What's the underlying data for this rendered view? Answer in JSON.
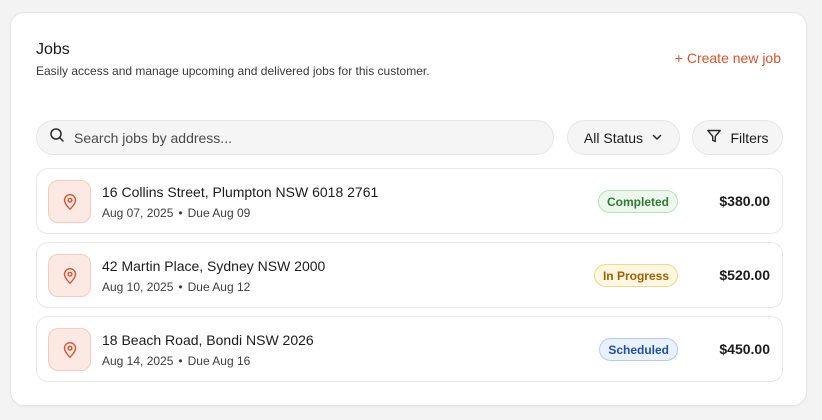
{
  "header": {
    "title": "Jobs",
    "subtitle": "Easily access and manage upcoming and delivered jobs for this customer.",
    "create_label": "+ Create new job"
  },
  "toolbar": {
    "search_placeholder": "Search jobs by address...",
    "search_value": "",
    "status_label": "All Status",
    "filters_label": "Filters"
  },
  "colors": {
    "accent": "#d9532b",
    "completed": "#2f7a34",
    "in_progress": "#a45d00",
    "scheduled": "#1f4fa6"
  },
  "jobs": [
    {
      "address": "16 Collins Street, Plumpton NSW 6018 2761",
      "date": "Aug 07, 2025",
      "separator": "•",
      "due": "Due Aug 09",
      "status": "Completed",
      "amount": "$380.00"
    },
    {
      "address": "42 Martin Place, Sydney NSW 2000",
      "date": "Aug 10, 2025",
      "separator": "•",
      "due": "Due Aug 12",
      "status": "In Progress",
      "amount": "$520.00"
    },
    {
      "address": "18 Beach Road, Bondi NSW 2026",
      "date": "Aug 14, 2025",
      "separator": "•",
      "due": "Due Aug 16",
      "status": "Scheduled",
      "amount": "$450.00"
    }
  ]
}
